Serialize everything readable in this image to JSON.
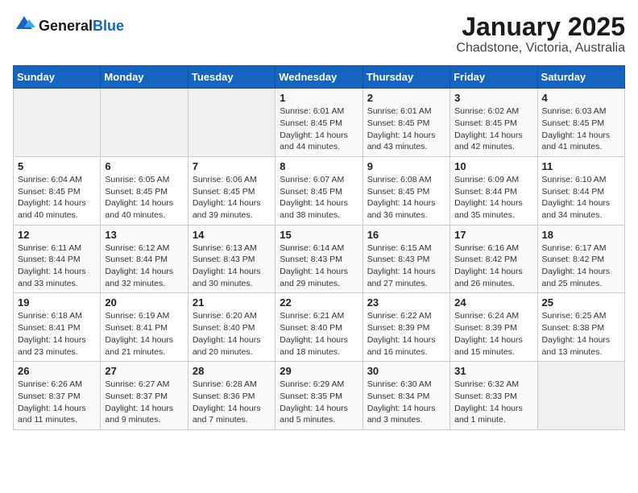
{
  "header": {
    "logo_general": "General",
    "logo_blue": "Blue",
    "title": "January 2025",
    "subtitle": "Chadstone, Victoria, Australia"
  },
  "calendar": {
    "days_of_week": [
      "Sunday",
      "Monday",
      "Tuesday",
      "Wednesday",
      "Thursday",
      "Friday",
      "Saturday"
    ],
    "weeks": [
      [
        {
          "day": "",
          "info": ""
        },
        {
          "day": "",
          "info": ""
        },
        {
          "day": "",
          "info": ""
        },
        {
          "day": "1",
          "info": "Sunrise: 6:01 AM\nSunset: 8:45 PM\nDaylight: 14 hours\nand 44 minutes."
        },
        {
          "day": "2",
          "info": "Sunrise: 6:01 AM\nSunset: 8:45 PM\nDaylight: 14 hours\nand 43 minutes."
        },
        {
          "day": "3",
          "info": "Sunrise: 6:02 AM\nSunset: 8:45 PM\nDaylight: 14 hours\nand 42 minutes."
        },
        {
          "day": "4",
          "info": "Sunrise: 6:03 AM\nSunset: 8:45 PM\nDaylight: 14 hours\nand 41 minutes."
        }
      ],
      [
        {
          "day": "5",
          "info": "Sunrise: 6:04 AM\nSunset: 8:45 PM\nDaylight: 14 hours\nand 40 minutes."
        },
        {
          "day": "6",
          "info": "Sunrise: 6:05 AM\nSunset: 8:45 PM\nDaylight: 14 hours\nand 40 minutes."
        },
        {
          "day": "7",
          "info": "Sunrise: 6:06 AM\nSunset: 8:45 PM\nDaylight: 14 hours\nand 39 minutes."
        },
        {
          "day": "8",
          "info": "Sunrise: 6:07 AM\nSunset: 8:45 PM\nDaylight: 14 hours\nand 38 minutes."
        },
        {
          "day": "9",
          "info": "Sunrise: 6:08 AM\nSunset: 8:45 PM\nDaylight: 14 hours\nand 36 minutes."
        },
        {
          "day": "10",
          "info": "Sunrise: 6:09 AM\nSunset: 8:44 PM\nDaylight: 14 hours\nand 35 minutes."
        },
        {
          "day": "11",
          "info": "Sunrise: 6:10 AM\nSunset: 8:44 PM\nDaylight: 14 hours\nand 34 minutes."
        }
      ],
      [
        {
          "day": "12",
          "info": "Sunrise: 6:11 AM\nSunset: 8:44 PM\nDaylight: 14 hours\nand 33 minutes."
        },
        {
          "day": "13",
          "info": "Sunrise: 6:12 AM\nSunset: 8:44 PM\nDaylight: 14 hours\nand 32 minutes."
        },
        {
          "day": "14",
          "info": "Sunrise: 6:13 AM\nSunset: 8:43 PM\nDaylight: 14 hours\nand 30 minutes."
        },
        {
          "day": "15",
          "info": "Sunrise: 6:14 AM\nSunset: 8:43 PM\nDaylight: 14 hours\nand 29 minutes."
        },
        {
          "day": "16",
          "info": "Sunrise: 6:15 AM\nSunset: 8:43 PM\nDaylight: 14 hours\nand 27 minutes."
        },
        {
          "day": "17",
          "info": "Sunrise: 6:16 AM\nSunset: 8:42 PM\nDaylight: 14 hours\nand 26 minutes."
        },
        {
          "day": "18",
          "info": "Sunrise: 6:17 AM\nSunset: 8:42 PM\nDaylight: 14 hours\nand 25 minutes."
        }
      ],
      [
        {
          "day": "19",
          "info": "Sunrise: 6:18 AM\nSunset: 8:41 PM\nDaylight: 14 hours\nand 23 minutes."
        },
        {
          "day": "20",
          "info": "Sunrise: 6:19 AM\nSunset: 8:41 PM\nDaylight: 14 hours\nand 21 minutes."
        },
        {
          "day": "21",
          "info": "Sunrise: 6:20 AM\nSunset: 8:40 PM\nDaylight: 14 hours\nand 20 minutes."
        },
        {
          "day": "22",
          "info": "Sunrise: 6:21 AM\nSunset: 8:40 PM\nDaylight: 14 hours\nand 18 minutes."
        },
        {
          "day": "23",
          "info": "Sunrise: 6:22 AM\nSunset: 8:39 PM\nDaylight: 14 hours\nand 16 minutes."
        },
        {
          "day": "24",
          "info": "Sunrise: 6:24 AM\nSunset: 8:39 PM\nDaylight: 14 hours\nand 15 minutes."
        },
        {
          "day": "25",
          "info": "Sunrise: 6:25 AM\nSunset: 8:38 PM\nDaylight: 14 hours\nand 13 minutes."
        }
      ],
      [
        {
          "day": "26",
          "info": "Sunrise: 6:26 AM\nSunset: 8:37 PM\nDaylight: 14 hours\nand 11 minutes."
        },
        {
          "day": "27",
          "info": "Sunrise: 6:27 AM\nSunset: 8:37 PM\nDaylight: 14 hours\nand 9 minutes."
        },
        {
          "day": "28",
          "info": "Sunrise: 6:28 AM\nSunset: 8:36 PM\nDaylight: 14 hours\nand 7 minutes."
        },
        {
          "day": "29",
          "info": "Sunrise: 6:29 AM\nSunset: 8:35 PM\nDaylight: 14 hours\nand 5 minutes."
        },
        {
          "day": "30",
          "info": "Sunrise: 6:30 AM\nSunset: 8:34 PM\nDaylight: 14 hours\nand 3 minutes."
        },
        {
          "day": "31",
          "info": "Sunrise: 6:32 AM\nSunset: 8:33 PM\nDaylight: 14 hours\nand 1 minute."
        },
        {
          "day": "",
          "info": ""
        }
      ]
    ]
  }
}
